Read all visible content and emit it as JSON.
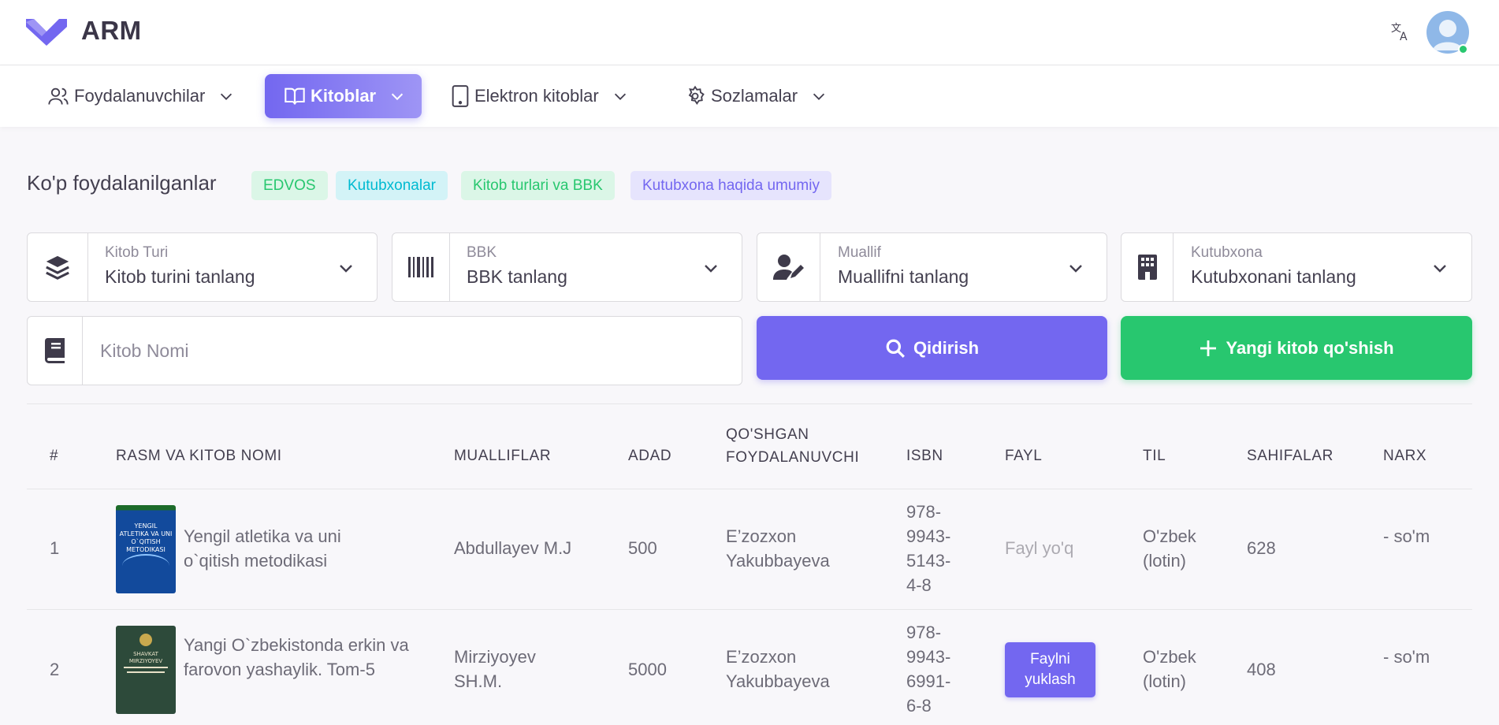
{
  "app": {
    "title": "ARM",
    "brand_color": "#7367f0"
  },
  "nav": {
    "items": [
      {
        "label": "Foydalanuvchilar",
        "icon": "users-icon",
        "active": false
      },
      {
        "label": "Kitoblar",
        "icon": "book-open-icon",
        "active": true
      },
      {
        "label": "Elektron kitoblar",
        "icon": "tablet-icon",
        "active": false
      },
      {
        "label": "Sozlamalar",
        "icon": "gear-icon",
        "active": false
      }
    ]
  },
  "page": {
    "title": "Ko'p foydalanilganlar",
    "badges": [
      "EDVOS",
      "Kutubxonalar",
      "Kitob turlari va BBK",
      "Kutubxona haqida umumiy"
    ]
  },
  "filters": [
    {
      "label": "Kitob Turi",
      "value": "Kitob turini tanlang",
      "icon": "layers-icon"
    },
    {
      "label": "BBK",
      "value": "BBK tanlang",
      "icon": "barcode-icon"
    },
    {
      "label": "Muallif",
      "value": "Muallifni tanlang",
      "icon": "user-edit-icon"
    },
    {
      "label": "Kutubxona",
      "value": "Kutubxonani tanlang",
      "icon": "building-icon"
    }
  ],
  "search": {
    "placeholder": "Kitob Nomi",
    "value": ""
  },
  "buttons": {
    "search": "Qidirish",
    "add": "Yangi kitob qo'shish"
  },
  "table": {
    "headers": {
      "num": "#",
      "title": "RASM VA KITOB NOMI",
      "authors": "MUALLIFLAR",
      "count": "ADAD",
      "added_by": "QO'SHGAN FOYDALANUVCHI",
      "isbn": "ISBN",
      "file": "FAYL",
      "lang": "TIL",
      "pages": "SAHIFALAR",
      "price": "NARX"
    },
    "rows": [
      {
        "num": "1",
        "title": "Yengil atletika va uni o`qitish metodikasi",
        "cover_text": "YENGIL ATLETIKA VA UNI O`QITISH METODIKASI",
        "authors": "Abdullayev M.J",
        "count": "500",
        "added_by": "E’zozxon Yakubbayeva",
        "isbn": "978-9943-5143-4-8",
        "file": "Fayl yo'q",
        "lang": "O'zbek (lotin)",
        "pages": "628",
        "price": "- so'm"
      },
      {
        "num": "2",
        "title": "Yangi O`zbekistonda erkin va farovon yashaylik. Tom-5",
        "cover_text": "SHAVKAT MIRZIYOYEV",
        "authors": "Mirziyoyev SH.M.",
        "count": "5000",
        "added_by": "E’zozxon Yakubbayeva",
        "isbn": "978-9943-6991-6-8",
        "file": "Faylni yuklash",
        "lang": "O'zbek (lotin)",
        "pages": "408",
        "price": "- so'm"
      }
    ]
  }
}
